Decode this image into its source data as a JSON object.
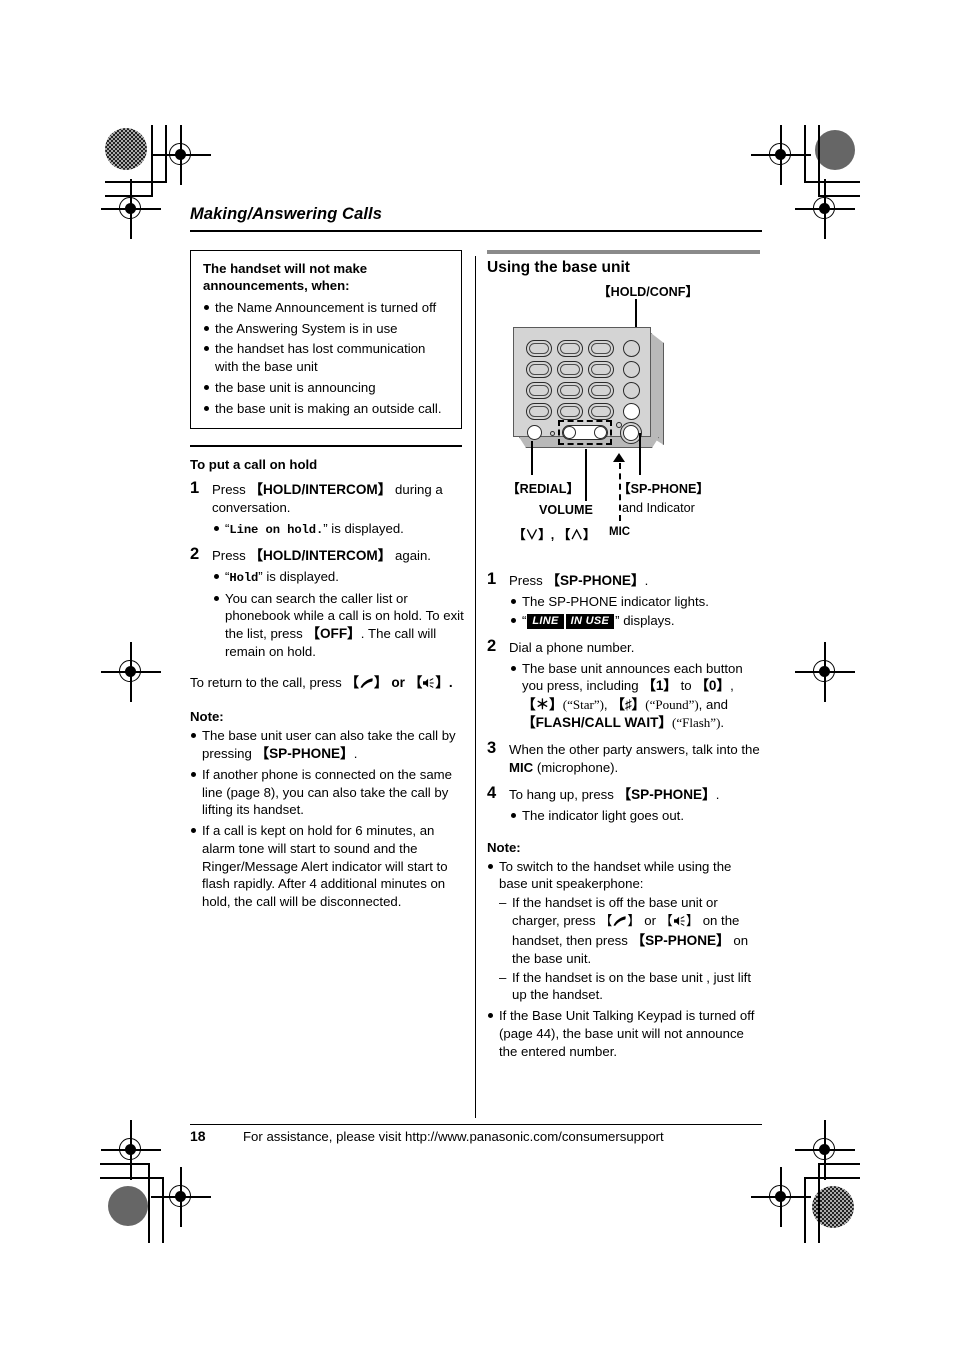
{
  "chapter": {
    "title": "Making/Answering Calls"
  },
  "left_column": {
    "callout": {
      "heading": "The handset will not make announcements, when:",
      "items": [
        "the Name Announcement is turned off",
        "the Answering System is in use",
        "the handset has lost communication with the base unit",
        "the base unit is announcing",
        "the base unit is making an outside call."
      ]
    },
    "hold_section": {
      "heading": "To put a call on hold",
      "steps": [
        {
          "num": "1",
          "text_pre": "Press ",
          "key": "【HOLD/INTERCOM】",
          "text_post": " during a conversation.",
          "bullets": [
            {
              "quote_open": "“",
              "mono": "Line on hold.",
              "quote_close": "”",
              "tail": " is displayed."
            }
          ]
        },
        {
          "num": "2",
          "text_pre": "Press ",
          "key": "【HOLD/INTERCOM】",
          "text_post": " again.",
          "bullets": [
            {
              "quote_open": "“",
              "mono": "Hold",
              "quote_close": "”",
              "tail": " is displayed."
            }
          ],
          "bullet2_pre": "You can search the caller list or phonebook while a call is on hold. To exit the list, press ",
          "bullet2_key": "【OFF】",
          "bullet2_post": ". The call will remain on hold."
        }
      ],
      "return_pre": "To return to the call, press ",
      "return_key1": "【",
      "return_icon1": "handset-offhook-icon",
      "return_mid": "】 or ",
      "return_key2": "【",
      "return_icon2": "speakerphone-icon",
      "return_post": "】."
    },
    "note": {
      "heading": "Note:",
      "items": [
        {
          "pre": "The base unit user can also take the call by pressing ",
          "key": "【SP-PHONE】",
          "post": "."
        },
        {
          "pre": "If another phone is connected on the same line (page 8), you can also take the call by lifting its handset.",
          "key": "",
          "post": ""
        },
        {
          "pre": "If a call is kept on hold for 6 minutes, an alarm tone will start to sound and the Ringer/Message Alert indicator will start to flash rapidly. After 4 additional minutes on hold, the call will be disconnected.",
          "key": "",
          "post": ""
        }
      ]
    }
  },
  "right_column": {
    "section_title": "Using the base unit",
    "figure": {
      "labels": {
        "hold_conf": "【HOLD/CONF】",
        "redial": "【REDIAL】",
        "volume": "VOLUME",
        "volume_keys": "【∨】, 【∧】",
        "mic": "MIC",
        "sp_phone": "【SP-PHONE】",
        "sp_phone_sub": "and Indicator"
      }
    },
    "steps": [
      {
        "num": "1",
        "pre": "Press ",
        "key": "【SP-PHONE】",
        "post": ".",
        "bullets": [
          {
            "text": "The SP-PHONE indicator lights."
          },
          {
            "quote_open": "“",
            "badge1": "LINE",
            "badge2": "IN USE",
            "quote_close": "”",
            "tail": " displays."
          }
        ]
      },
      {
        "num": "2",
        "pre": "Dial a phone number.",
        "key": "",
        "post": "",
        "bullet_rich": {
          "p1": "The base unit announces each button you press, including ",
          "k1": "【1】",
          "p2": " to ",
          "k2": "【0】",
          "p3": ", ",
          "k3": "【＊】",
          "q1": "(“Star”)",
          "p4": ", ",
          "k4": "【♯】",
          "q2": "(“Pound”)",
          "p5": ", and ",
          "k5": "【FLASH/CALL WAIT】",
          "q3": "(“Flash”)",
          "p6": "."
        }
      },
      {
        "num": "3",
        "pre": "When the other party answers, talk into the ",
        "key": "MIC",
        "post": " (microphone)."
      },
      {
        "num": "4",
        "pre": "To hang up, press ",
        "key": "【SP-PHONE】",
        "post": ".",
        "bullets": [
          {
            "text": "The indicator light goes out."
          }
        ]
      }
    ],
    "note": {
      "heading": "Note:",
      "bullet1": "To switch to the handset while using the base unit speakerphone:",
      "dash1_pre": "If the handset is off the base unit or charger, press 【",
      "dash1_icon1": "handset-offhook-icon",
      "dash1_mid": "】 or 【",
      "dash1_icon2": "speakerphone-icon",
      "dash1_mid2": "】 on the handset, then press ",
      "dash1_key": "【SP-PHONE】",
      "dash1_post": " on the base unit.",
      "dash2": "If the handset is on the base unit , just lift up the handset.",
      "bullet2": "If the Base Unit Talking Keypad is turned off (page 44), the base unit will not announce the entered number."
    }
  },
  "footer": {
    "page_number": "18",
    "text": "For assistance, please visit http://www.panasonic.com/consumersupport"
  },
  "colors": {
    "rule_gray": "#8a8a8a",
    "unit_body": "#d4d4d4",
    "unit_edge": "#b9b9b9",
    "badge_bg": "#000000"
  }
}
